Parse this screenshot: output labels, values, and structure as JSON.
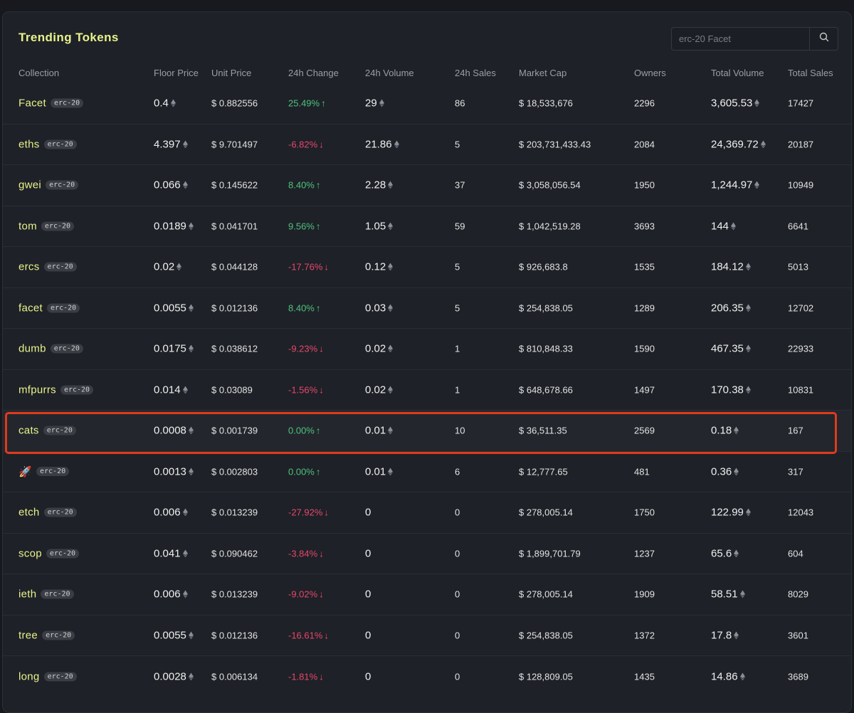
{
  "title": "Trending Tokens",
  "search": {
    "placeholder": "erc-20 Facet",
    "icon": "search-icon"
  },
  "columns": [
    "Collection",
    "Floor Price",
    "Unit Price",
    "24h Change",
    "24h Volume",
    "24h Sales",
    "Market Cap",
    "Owners",
    "Total Volume",
    "Total Sales"
  ],
  "colors": {
    "accent": "#e8f28c",
    "up": "#4fc27e",
    "down": "#e5476b",
    "highlight": "#e03a1e"
  },
  "highlighted_row": 8,
  "rows": [
    {
      "name": "Facet",
      "badge": "erc-20",
      "floor": "0.4",
      "unit": "$ 0.882556",
      "change": "25.49%",
      "dir": "up",
      "volume": "29",
      "sales": "86",
      "mcap": "$ 18,533,676",
      "owners": "2296",
      "total_volume": "3,605.53",
      "total_sales": "17427"
    },
    {
      "name": "eths",
      "badge": "erc-20",
      "floor": "4.397",
      "unit": "$ 9.701497",
      "change": "-6.82%",
      "dir": "down",
      "volume": "21.86",
      "sales": "5",
      "mcap": "$ 203,731,433.43",
      "owners": "2084",
      "total_volume": "24,369.72",
      "total_sales": "20187"
    },
    {
      "name": "gwei",
      "badge": "erc-20",
      "floor": "0.066",
      "unit": "$ 0.145622",
      "change": "8.40%",
      "dir": "up",
      "volume": "2.28",
      "sales": "37",
      "mcap": "$ 3,058,056.54",
      "owners": "1950",
      "total_volume": "1,244.97",
      "total_sales": "10949"
    },
    {
      "name": "tom",
      "badge": "erc-20",
      "floor": "0.0189",
      "unit": "$ 0.041701",
      "change": "9.56%",
      "dir": "up",
      "volume": "1.05",
      "sales": "59",
      "mcap": "$ 1,042,519.28",
      "owners": "3693",
      "total_volume": "144",
      "total_sales": "6641"
    },
    {
      "name": "ercs",
      "badge": "erc-20",
      "floor": "0.02",
      "unit": "$ 0.044128",
      "change": "-17.76%",
      "dir": "down",
      "volume": "0.12",
      "sales": "5",
      "mcap": "$ 926,683.8",
      "owners": "1535",
      "total_volume": "184.12",
      "total_sales": "5013"
    },
    {
      "name": "facet",
      "badge": "erc-20",
      "floor": "0.0055",
      "unit": "$ 0.012136",
      "change": "8.40%",
      "dir": "up",
      "volume": "0.03",
      "sales": "5",
      "mcap": "$ 254,838.05",
      "owners": "1289",
      "total_volume": "206.35",
      "total_sales": "12702"
    },
    {
      "name": "dumb",
      "badge": "erc-20",
      "floor": "0.0175",
      "unit": "$ 0.038612",
      "change": "-9.23%",
      "dir": "down",
      "volume": "0.02",
      "sales": "1",
      "mcap": "$ 810,848.33",
      "owners": "1590",
      "total_volume": "467.35",
      "total_sales": "22933"
    },
    {
      "name": "mfpurrs",
      "badge": "erc-20",
      "floor": "0.014",
      "unit": "$ 0.03089",
      "change": "-1.56%",
      "dir": "down",
      "volume": "0.02",
      "sales": "1",
      "mcap": "$ 648,678.66",
      "owners": "1497",
      "total_volume": "170.38",
      "total_sales": "10831"
    },
    {
      "name": "cats",
      "badge": "erc-20",
      "floor": "0.0008",
      "unit": "$ 0.001739",
      "change": "0.00%",
      "dir": "up",
      "volume": "0.01",
      "sales": "10",
      "mcap": "$ 36,511.35",
      "owners": "2569",
      "total_volume": "0.18",
      "total_sales": "167"
    },
    {
      "name": "🚀",
      "badge": "erc-20",
      "floor": "0.0013",
      "unit": "$ 0.002803",
      "change": "0.00%",
      "dir": "up",
      "volume": "0.01",
      "sales": "6",
      "mcap": "$ 12,777.65",
      "owners": "481",
      "total_volume": "0.36",
      "total_sales": "317"
    },
    {
      "name": "etch",
      "badge": "erc-20",
      "floor": "0.006",
      "unit": "$ 0.013239",
      "change": "-27.92%",
      "dir": "down",
      "volume": "0",
      "sales": "0",
      "mcap": "$ 278,005.14",
      "owners": "1750",
      "total_volume": "122.99",
      "total_sales": "12043"
    },
    {
      "name": "scop",
      "badge": "erc-20",
      "floor": "0.041",
      "unit": "$ 0.090462",
      "change": "-3.84%",
      "dir": "down",
      "volume": "0",
      "sales": "0",
      "mcap": "$ 1,899,701.79",
      "owners": "1237",
      "total_volume": "65.6",
      "total_sales": "604"
    },
    {
      "name": "ieth",
      "badge": "erc-20",
      "floor": "0.006",
      "unit": "$ 0.013239",
      "change": "-9.02%",
      "dir": "down",
      "volume": "0",
      "sales": "0",
      "mcap": "$ 278,005.14",
      "owners": "1909",
      "total_volume": "58.51",
      "total_sales": "8029"
    },
    {
      "name": "tree",
      "badge": "erc-20",
      "floor": "0.0055",
      "unit": "$ 0.012136",
      "change": "-16.61%",
      "dir": "down",
      "volume": "0",
      "sales": "0",
      "mcap": "$ 254,838.05",
      "owners": "1372",
      "total_volume": "17.8",
      "total_sales": "3601"
    },
    {
      "name": "long",
      "badge": "erc-20",
      "floor": "0.0028",
      "unit": "$ 0.006134",
      "change": "-1.81%",
      "dir": "down",
      "volume": "0",
      "sales": "0",
      "mcap": "$ 128,809.05",
      "owners": "1435",
      "total_volume": "14.86",
      "total_sales": "3689"
    }
  ]
}
